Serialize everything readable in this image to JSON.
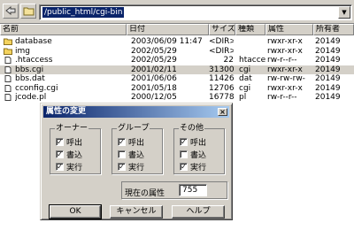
{
  "toolbar": {
    "path": "/public_html/cgi-bin",
    "back_icon": "back-arrow-icon",
    "folder_icon": "folder-open-icon"
  },
  "columns": [
    "名前",
    "日付",
    "サイズ",
    "種類",
    "属性",
    "所有者"
  ],
  "files": [
    {
      "name": "database",
      "date": "2003/06/09 11:47",
      "size": "<DIR>",
      "type": "",
      "attr": "rwxr-xr-x",
      "owner": "20149",
      "icon": "folder"
    },
    {
      "name": "img",
      "date": "2002/05/29",
      "size": "<DIR>",
      "type": "",
      "attr": "rwxr-xr-x",
      "owner": "20149",
      "icon": "folder"
    },
    {
      "name": ".htaccess",
      "date": "2002/05/29",
      "size": "22",
      "type": "htaccess",
      "attr": "rw-r--r--",
      "owner": "20149",
      "icon": "file"
    },
    {
      "name": "bbs.cgi",
      "date": "2001/02/11",
      "size": "31300",
      "type": "cgi",
      "attr": "rwxr-xr-x",
      "owner": "20149",
      "icon": "file"
    },
    {
      "name": "bbs.dat",
      "date": "2001/06/06",
      "size": "11426",
      "type": "dat",
      "attr": "rw-rw-rw-",
      "owner": "20149",
      "icon": "file"
    },
    {
      "name": "cconfig.cgi",
      "date": "2001/05/18",
      "size": "12706",
      "type": "cgi",
      "attr": "rwxr-xr-x",
      "owner": "20149",
      "icon": "file"
    },
    {
      "name": "jcode.pl",
      "date": "2000/12/05",
      "size": "16778",
      "type": "pl",
      "attr": "rw-r--r--",
      "owner": "20149",
      "icon": "file"
    }
  ],
  "selected_index": 3,
  "dialog": {
    "title": "属性の変更",
    "close": "×",
    "groups": [
      {
        "label": "オーナー",
        "items": [
          {
            "label": "呼出",
            "checked": true
          },
          {
            "label": "書込",
            "checked": true
          },
          {
            "label": "実行",
            "checked": true
          }
        ]
      },
      {
        "label": "グループ",
        "items": [
          {
            "label": "呼出",
            "checked": true
          },
          {
            "label": "書込",
            "checked": false
          },
          {
            "label": "実行",
            "checked": true
          }
        ]
      },
      {
        "label": "その他",
        "items": [
          {
            "label": "呼出",
            "checked": true
          },
          {
            "label": "書込",
            "checked": false
          },
          {
            "label": "実行",
            "checked": true
          }
        ]
      }
    ],
    "current_label": "現在の属性",
    "current_value": "755",
    "ok": "OK",
    "cancel": "キャンセル",
    "help": "ヘルプ"
  }
}
